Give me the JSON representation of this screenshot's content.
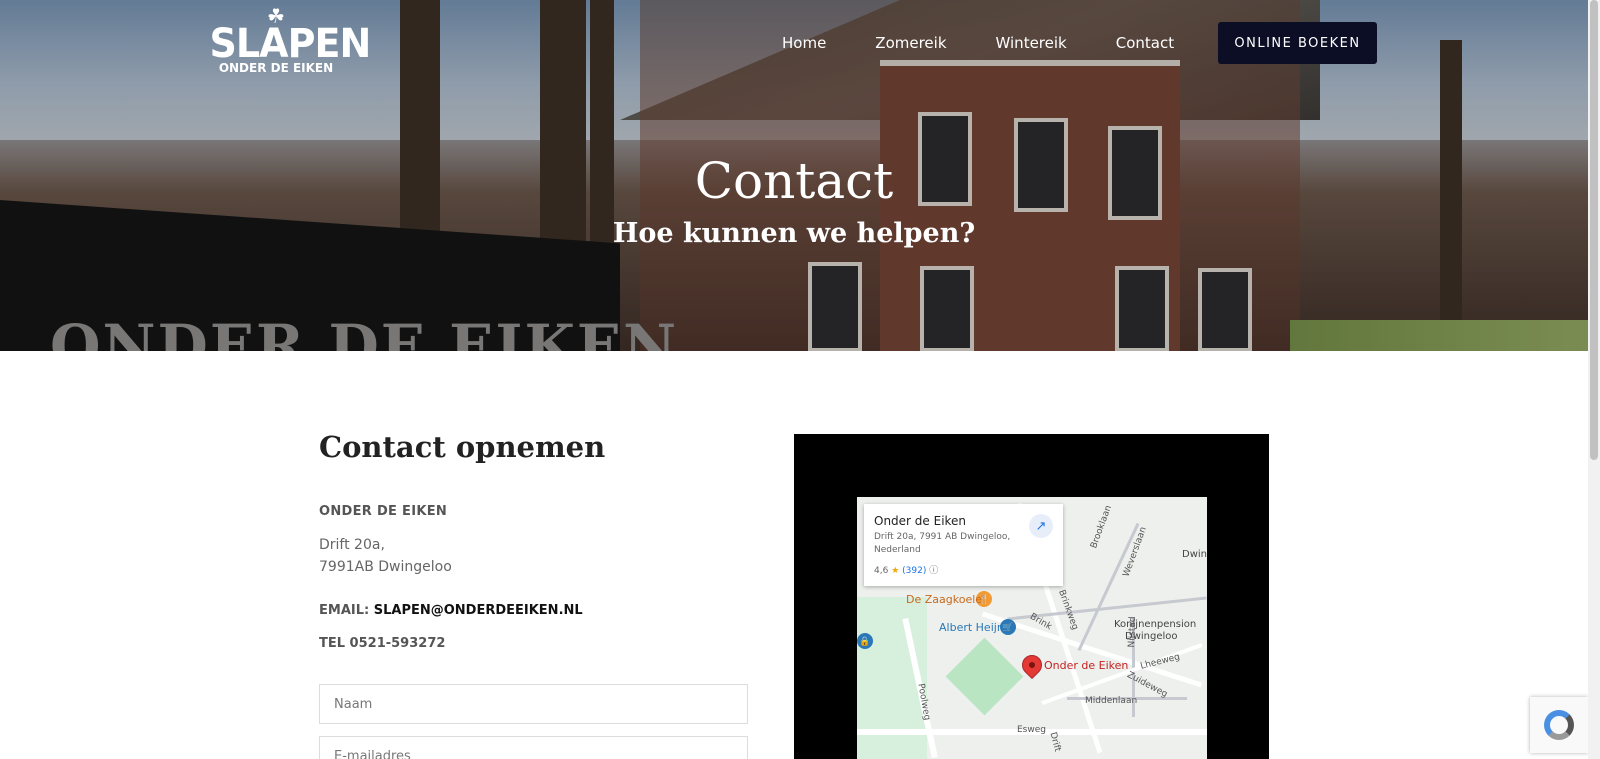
{
  "header": {
    "logo": {
      "word": "SLAPEN",
      "sub": "ONDER DE EIKEN"
    },
    "nav": [
      "Home",
      "Zomereik",
      "Wintereik",
      "Contact"
    ],
    "cta": "ONLINE BOEKEN"
  },
  "hero": {
    "title": "Contact",
    "subtitle": "Hoe kunnen we helpen?",
    "sign_text": "ONDER DE EIKEN"
  },
  "contact": {
    "heading": "Contact opnemen",
    "company": "ONDER DE EIKEN",
    "address_line1": "Drift 20a,",
    "address_line2": "7991AB Dwingeloo",
    "email_label": "EMAIL:",
    "email_value": "SLAPEN@ONDERDEEIKEN.NL",
    "tel": "TEL 0521-593272",
    "form": {
      "name_placeholder": "Naam",
      "email_placeholder": "E-mailadres"
    }
  },
  "map": {
    "card": {
      "name": "Onder de Eiken",
      "address": "Drift 20a, 7991 AB Dwingeloo, Nederland",
      "rating": "4,6",
      "reviews": "(392)"
    },
    "labels": {
      "pin": "Onder de Eiken",
      "zaagkoele": "De Zaagkoele",
      "albert_heijn": "Albert Heijn",
      "konijnenpension_1": "Konijnenpension",
      "konijnenpension_2": "Dwingeloo",
      "brink": "Brink",
      "brinkweg": "Brinkweg",
      "lheeweg": "Lheeweg",
      "zuideweg": "Zuideweg",
      "middenlaan": "Middenlaan",
      "esweg": "Esweg",
      "poolweg": "Poolweg",
      "drift": "Drift",
      "nijstad": "Nijstad",
      "brooklaan": "Brooklaan",
      "weverslaan": "Weverslaan",
      "dwin": "Dwin"
    }
  },
  "colors": {
    "cta_bg": "#0b0e25",
    "pin": "#e53935",
    "map_water_poi": "#2a78b8",
    "map_food_poi": "#f29b35"
  },
  "icons": {
    "external_link": "external-link-icon",
    "info": "info-icon",
    "star": "star-icon",
    "recaptcha": "recaptcha-icon",
    "password_manager": "password-manager-icon"
  }
}
